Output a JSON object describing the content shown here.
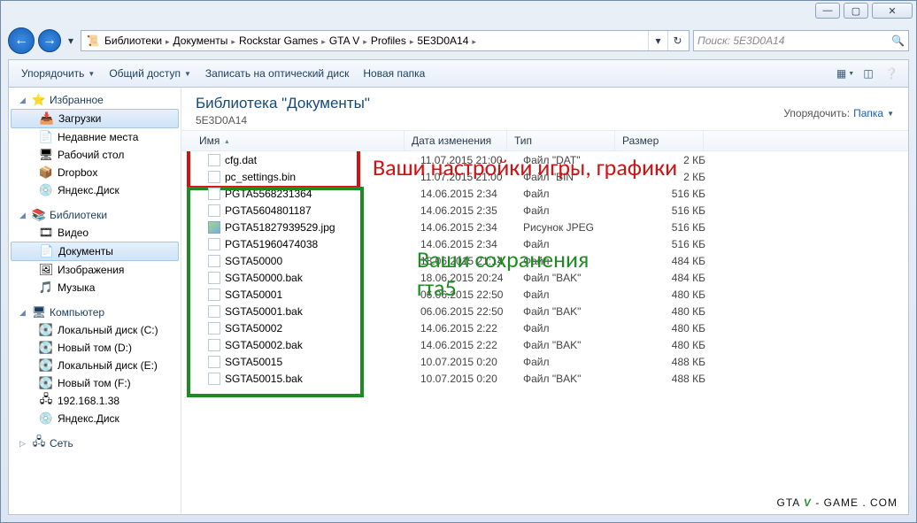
{
  "window": {
    "min": "—",
    "max": "▢",
    "close": "✕"
  },
  "breadcrumbs": [
    "Библиотеки",
    "Документы",
    "Rockstar Games",
    "GTA V",
    "Profiles",
    "5E3D0A14"
  ],
  "search_placeholder": "Поиск: 5E3D0A14",
  "toolbar": {
    "organize": "Упорядочить",
    "share": "Общий доступ",
    "burn": "Записать на оптический диск",
    "newfolder": "Новая папка"
  },
  "library": {
    "title": "Библиотека \"Документы\"",
    "subtitle": "5E3D0A14",
    "sort_label": "Упорядочить:",
    "sort_value": "Папка"
  },
  "columns": {
    "name": "Имя",
    "date": "Дата изменения",
    "type": "Тип",
    "size": "Размер"
  },
  "sidebar": {
    "favorites": "Избранное",
    "fav_items": [
      "Загрузки",
      "Недавние места",
      "Рабочий стол",
      "Dropbox",
      "Яндекс.Диск"
    ],
    "libraries": "Библиотеки",
    "lib_items": [
      "Видео",
      "Документы",
      "Изображения",
      "Музыка"
    ],
    "computer": "Компьютер",
    "comp_items": [
      "Локальный диск (C:)",
      "Новый том (D:)",
      "Локальный диск (E:)",
      "Новый том (F:)",
      "192.168.1.38",
      "Яндекс.Диск"
    ],
    "network": "Сеть"
  },
  "files": [
    {
      "name": "cfg.dat",
      "date": "11.07.2015 21:00",
      "type": "Файл \"DAT\"",
      "size": "2 КБ",
      "img": false
    },
    {
      "name": "pc_settings.bin",
      "date": "11.07.2015 21:00",
      "type": "Файл \"BIN\"",
      "size": "2 КБ",
      "img": false
    },
    {
      "name": "PGTA5568231364",
      "date": "14.06.2015 2:34",
      "type": "Файл",
      "size": "516 КБ",
      "img": false
    },
    {
      "name": "PGTA5604801187",
      "date": "14.06.2015 2:35",
      "type": "Файл",
      "size": "516 КБ",
      "img": false
    },
    {
      "name": "PGTA51827939529.jpg",
      "date": "14.06.2015 2:34",
      "type": "Рисунок JPEG",
      "size": "516 КБ",
      "img": true
    },
    {
      "name": "PGTA51960474038",
      "date": "14.06.2015 2:34",
      "type": "Файл",
      "size": "516 КБ",
      "img": false
    },
    {
      "name": "SGTA50000",
      "date": "18.06.2015 21:14",
      "type": "Файл",
      "size": "484 КБ",
      "img": false
    },
    {
      "name": "SGTA50000.bak",
      "date": "18.06.2015 20:24",
      "type": "Файл \"BAK\"",
      "size": "484 КБ",
      "img": false
    },
    {
      "name": "SGTA50001",
      "date": "06.06.2015 22:50",
      "type": "Файл",
      "size": "480 КБ",
      "img": false
    },
    {
      "name": "SGTA50001.bak",
      "date": "06.06.2015 22:50",
      "type": "Файл \"BAK\"",
      "size": "480 КБ",
      "img": false
    },
    {
      "name": "SGTA50002",
      "date": "14.06.2015 2:22",
      "type": "Файл",
      "size": "480 КБ",
      "img": false
    },
    {
      "name": "SGTA50002.bak",
      "date": "14.06.2015 2:22",
      "type": "Файл \"BAK\"",
      "size": "480 КБ",
      "img": false
    },
    {
      "name": "SGTA50015",
      "date": "10.07.2015 0:20",
      "type": "Файл",
      "size": "488 КБ",
      "img": false
    },
    {
      "name": "SGTA50015.bak",
      "date": "10.07.2015 0:20",
      "type": "Файл \"BAK\"",
      "size": "488 КБ",
      "img": false
    }
  ],
  "annotations": {
    "red_text": "Ваши настройки игры, графики",
    "green_text1": "Ваши сохранения",
    "green_text2": "гта5"
  },
  "watermark": {
    "a": "GTA",
    "b": "V",
    "c": "- GAME . COM"
  },
  "fav_icons": [
    "📥",
    "📄",
    "🖥",
    "📦",
    "💿"
  ],
  "lib_icons": [
    "🎞",
    "📄",
    "🖼",
    "🎵"
  ],
  "comp_icons": [
    "💽",
    "💽",
    "💽",
    "💽",
    "🖧",
    "💿"
  ]
}
